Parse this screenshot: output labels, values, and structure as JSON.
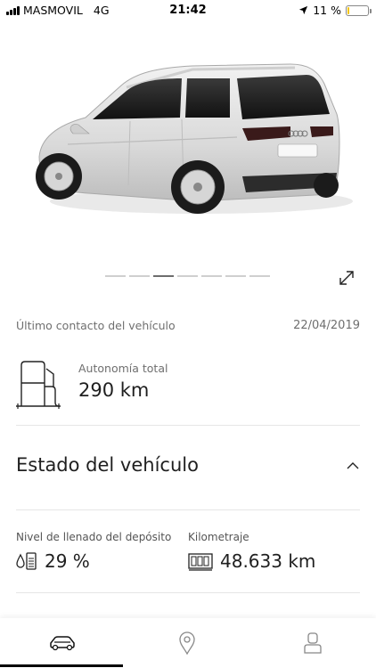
{
  "status_bar": {
    "carrier": "MASMOVIL",
    "network": "4G",
    "time": "21:42",
    "battery": "11 %",
    "battery_level": 0.11,
    "battery_color": "#f5c400"
  },
  "hero": {
    "image_alt_icon": "car-image",
    "slides_total": 7,
    "active_slide": 3,
    "expand_icon": "expand-icon"
  },
  "vehicle": {
    "last_contact_label": "Último contacto del vehículo",
    "last_contact_date": "22/04/2019",
    "autonomy_label": "Autonomía total",
    "autonomy_value": "290 km"
  },
  "status_section": {
    "title": "Estado del vehículo",
    "expanded": true,
    "fuel_label": "Nivel de llenado del depósito",
    "fuel_value": "29 %",
    "fuel_level": 0.29,
    "mileage_label": "Kilometraje",
    "mileage_value": "48.633 km"
  },
  "bottom_nav": {
    "tabs": [
      {
        "name": "vehicle",
        "icon": "car-icon",
        "active": true
      },
      {
        "name": "map",
        "icon": "map-pin-icon",
        "active": false
      },
      {
        "name": "profile",
        "icon": "user-icon",
        "active": false
      }
    ],
    "accent": "#000000"
  }
}
